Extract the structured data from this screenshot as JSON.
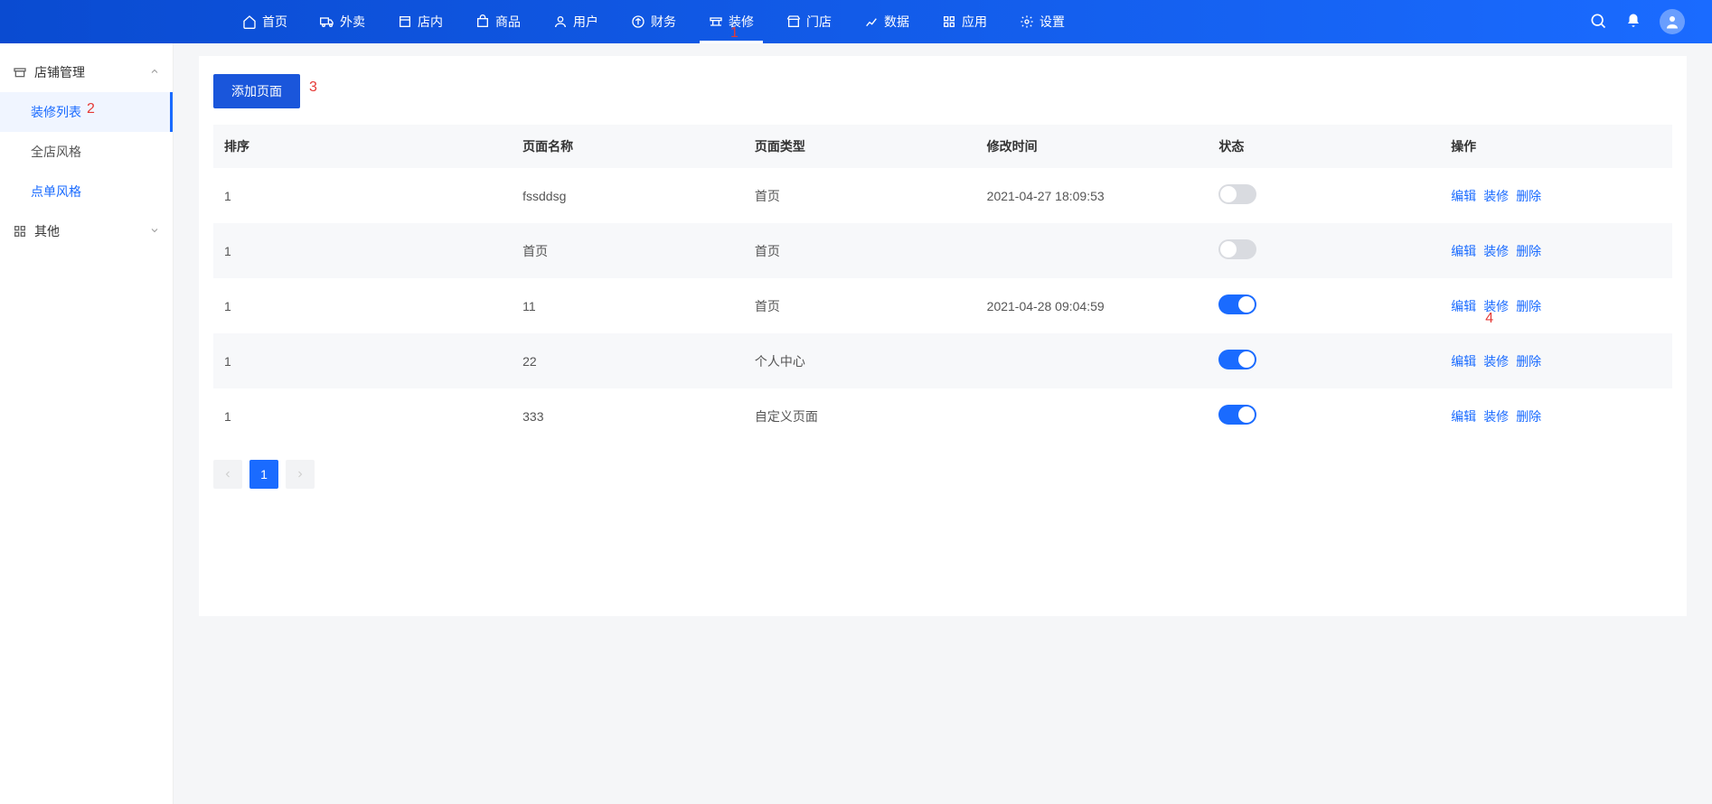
{
  "topnav": {
    "items": [
      {
        "icon": "home",
        "label": "首页"
      },
      {
        "icon": "truck",
        "label": "外卖"
      },
      {
        "icon": "store",
        "label": "店内"
      },
      {
        "icon": "bag",
        "label": "商品"
      },
      {
        "icon": "user",
        "label": "用户"
      },
      {
        "icon": "finance",
        "label": "财务"
      },
      {
        "icon": "decor",
        "label": "装修",
        "active": true
      },
      {
        "icon": "shop",
        "label": "门店"
      },
      {
        "icon": "chart",
        "label": "数据"
      },
      {
        "icon": "apps",
        "label": "应用"
      },
      {
        "icon": "gear",
        "label": "设置"
      }
    ]
  },
  "sidebar": {
    "group1": {
      "label": "店铺管理",
      "expanded": true
    },
    "subs1": [
      {
        "label": "装修列表",
        "active": true
      },
      {
        "label": "全店风格"
      },
      {
        "label": "点单风格",
        "link": true
      }
    ],
    "group2": {
      "label": "其他",
      "expanded": false
    }
  },
  "panel": {
    "add_btn": "添加页面"
  },
  "table": {
    "headers": {
      "sort": "排序",
      "name": "页面名称",
      "type": "页面类型",
      "time": "修改时间",
      "status": "状态",
      "ops": "操作"
    },
    "rows": [
      {
        "sort": "1",
        "name": "fssddsg",
        "type": "首页",
        "time": "2021-04-27 18:09:53",
        "status": false
      },
      {
        "sort": "1",
        "name": "首页",
        "type": "首页",
        "time": "",
        "status": false
      },
      {
        "sort": "1",
        "name": "11",
        "type": "首页",
        "time": "2021-04-28 09:04:59",
        "status": true
      },
      {
        "sort": "1",
        "name": "22",
        "type": "个人中心",
        "time": "",
        "status": true
      },
      {
        "sort": "1",
        "name": "333",
        "type": "自定义页面",
        "time": "",
        "status": true
      }
    ],
    "ops": {
      "edit": "编辑",
      "decor": "装修",
      "delete": "删除"
    }
  },
  "pager": {
    "current": "1"
  },
  "annotations": {
    "a1": "1",
    "a2": "2",
    "a3": "3",
    "a4": "4"
  }
}
